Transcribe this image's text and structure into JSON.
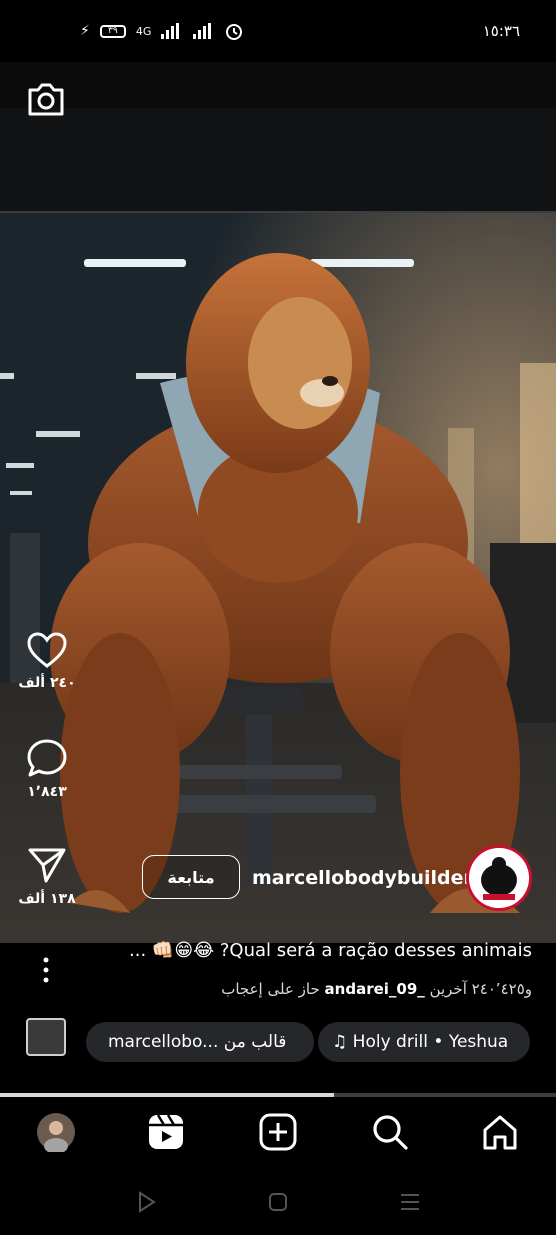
{
  "status_bar": {
    "time": "١٥:٣٦",
    "battery_level": "٣٩",
    "network": "4G",
    "signal_text": "٤G"
  },
  "camera": {
    "icon": "camera-icon"
  },
  "post": {
    "actions": {
      "like_count": "٢٤٠ ألف",
      "comment_count": "١٬٨٤٣",
      "share_count": "١٣٨ ألف"
    },
    "author": {
      "username": "marcellobodybuilder",
      "follow_label": "متابعة"
    },
    "caption": "... 👊🏻😁😂 ?Qual será a ração desses animais",
    "likes": {
      "prefix": "حاز على إعجاب",
      "user": "andarei_09_",
      "suffix": "و٢٤٠٬٤٢٥ آخرين"
    },
    "template_pill": "marcellobo... قالب من",
    "audio_pill": "Holy drill • Yeshua",
    "progress": 0.6
  },
  "nav": {
    "items": [
      "profile-avatar",
      "reels-icon",
      "create-icon",
      "search-icon",
      "home-icon"
    ]
  },
  "system_nav": [
    "back-icon",
    "home-square-icon",
    "menu-icon"
  ],
  "colors": {
    "background": "#000000",
    "pill_bg": "#26272b",
    "accent_red": "#c8102e"
  }
}
